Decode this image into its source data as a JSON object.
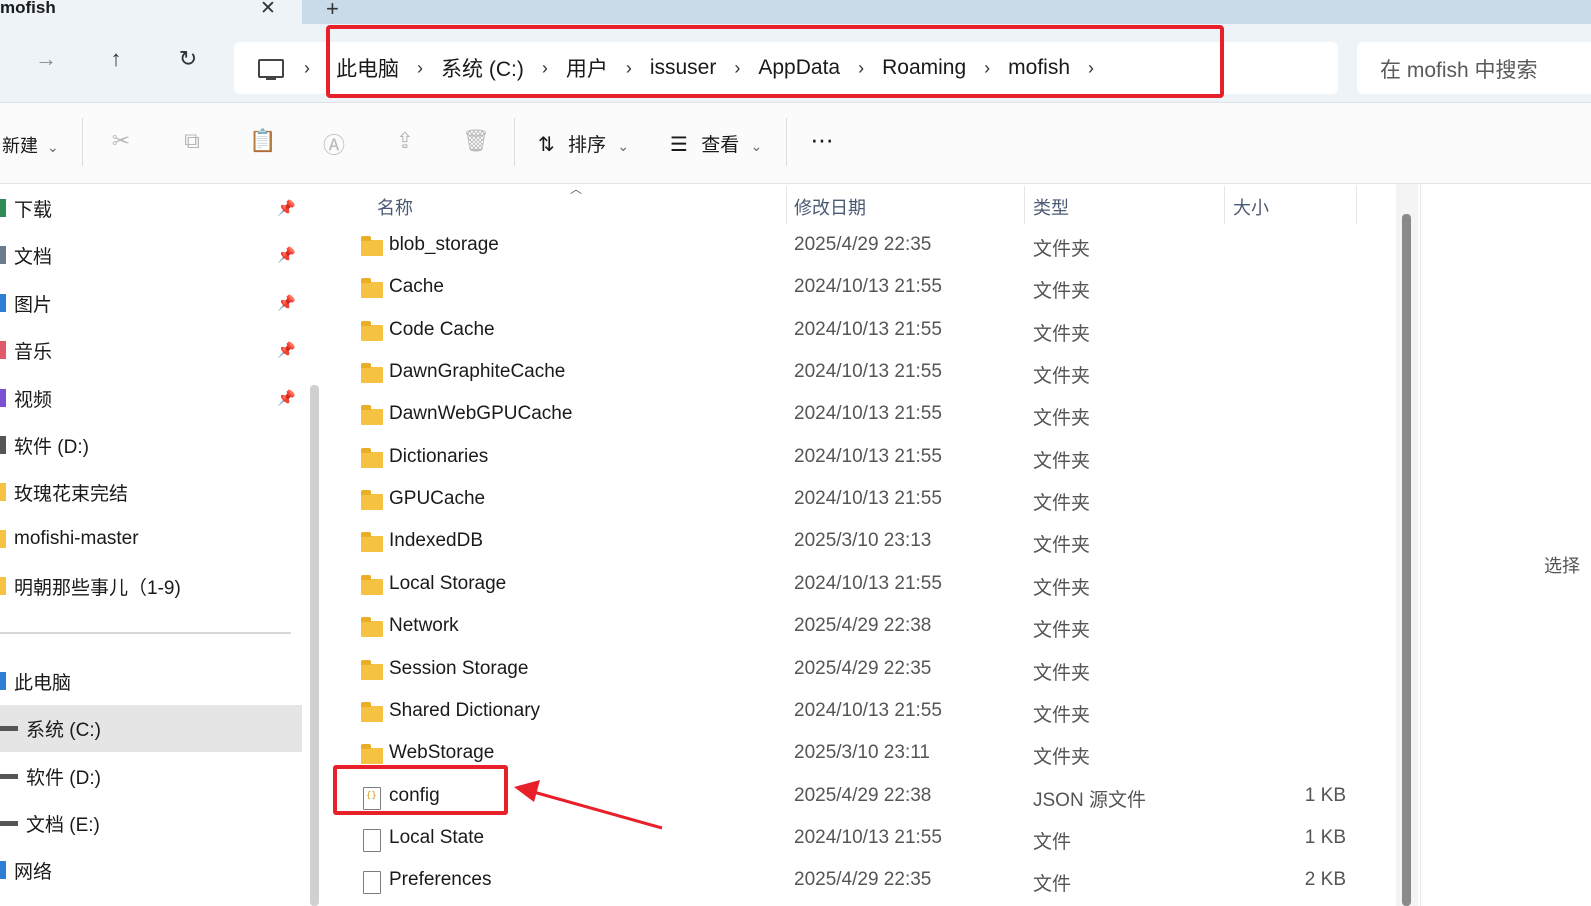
{
  "window": {
    "tab_title": "mofish",
    "close_glyph": "✕",
    "new_tab_glyph": "+"
  },
  "nav": {
    "forward_glyph": "→",
    "up_glyph": "↑",
    "refresh_glyph": "↻",
    "separator": "›",
    "breadcrumb": [
      "此电脑",
      "系统 (C:)",
      "用户",
      "issuser",
      "AppData",
      "Roaming",
      "mofish"
    ],
    "search_placeholder": "在 mofish 中搜索"
  },
  "toolbar": {
    "new_label": "新建",
    "sort_label": "排序",
    "view_label": "查看",
    "more_label": "···",
    "dropdown_glyph": "⌄",
    "icons": [
      "cut-icon",
      "copy-icon",
      "paste-icon",
      "rename-icon",
      "share-icon",
      "delete-icon"
    ]
  },
  "sidebar": {
    "quick_access": [
      {
        "label": "下载",
        "pinned": true,
        "color": "#2e8b57"
      },
      {
        "label": "文档",
        "pinned": true,
        "color": "#6b7b8c"
      },
      {
        "label": "图片",
        "pinned": true,
        "color": "#2d7fd3"
      },
      {
        "label": "音乐",
        "pinned": true,
        "color": "#e05a6a"
      },
      {
        "label": "视频",
        "pinned": true,
        "color": "#7a4fd0"
      },
      {
        "label": "软件 (D:)",
        "pinned": false,
        "color": "#555555"
      },
      {
        "label": "玫瑰花束完结",
        "pinned": false,
        "color": "#f5c242"
      },
      {
        "label": "mofishi-master",
        "pinned": false,
        "color": "#f5c242"
      },
      {
        "label": "明朝那些事儿（1-9)",
        "pinned": false,
        "color": "#f5c242"
      }
    ],
    "pin_glyph": "📌",
    "this_pc": [
      {
        "label": "此电脑",
        "color": "#2d7fd3"
      },
      {
        "label": "系统 (C:)",
        "color": "#555555",
        "selected": true
      },
      {
        "label": "软件 (D:)",
        "color": "#555555"
      },
      {
        "label": "文档 (E:)",
        "color": "#555555"
      },
      {
        "label": "网络",
        "color": "#2d7fd3"
      }
    ]
  },
  "columns": {
    "name": "名称",
    "date": "修改日期",
    "type": "类型",
    "size": "大小"
  },
  "files": [
    {
      "name": "blob_storage",
      "date": "2025/4/29 22:35",
      "type": "文件夹",
      "size": "",
      "kind": "folder"
    },
    {
      "name": "Cache",
      "date": "2024/10/13 21:55",
      "type": "文件夹",
      "size": "",
      "kind": "folder"
    },
    {
      "name": "Code Cache",
      "date": "2024/10/13 21:55",
      "type": "文件夹",
      "size": "",
      "kind": "folder"
    },
    {
      "name": "DawnGraphiteCache",
      "date": "2024/10/13 21:55",
      "type": "文件夹",
      "size": "",
      "kind": "folder"
    },
    {
      "name": "DawnWebGPUCache",
      "date": "2024/10/13 21:55",
      "type": "文件夹",
      "size": "",
      "kind": "folder"
    },
    {
      "name": "Dictionaries",
      "date": "2024/10/13 21:55",
      "type": "文件夹",
      "size": "",
      "kind": "folder"
    },
    {
      "name": "GPUCache",
      "date": "2024/10/13 21:55",
      "type": "文件夹",
      "size": "",
      "kind": "folder"
    },
    {
      "name": "IndexedDB",
      "date": "2025/3/10 23:13",
      "type": "文件夹",
      "size": "",
      "kind": "folder"
    },
    {
      "name": "Local Storage",
      "date": "2024/10/13 21:55",
      "type": "文件夹",
      "size": "",
      "kind": "folder"
    },
    {
      "name": "Network",
      "date": "2025/4/29 22:38",
      "type": "文件夹",
      "size": "",
      "kind": "folder"
    },
    {
      "name": "Session Storage",
      "date": "2025/4/29 22:35",
      "type": "文件夹",
      "size": "",
      "kind": "folder"
    },
    {
      "name": "Shared Dictionary",
      "date": "2024/10/13 21:55",
      "type": "文件夹",
      "size": "",
      "kind": "folder"
    },
    {
      "name": "WebStorage",
      "date": "2025/3/10 23:11",
      "type": "文件夹",
      "size": "",
      "kind": "folder"
    },
    {
      "name": "config",
      "date": "2025/4/29 22:38",
      "type": "JSON 源文件",
      "size": "1 KB",
      "kind": "json"
    },
    {
      "name": "Local State",
      "date": "2024/10/13 21:55",
      "type": "文件",
      "size": "1 KB",
      "kind": "file"
    },
    {
      "name": "Preferences",
      "date": "2025/4/29 22:35",
      "type": "文件",
      "size": "2 KB",
      "kind": "file"
    }
  ],
  "right_pane_hint": "选择",
  "annotation": {
    "highlight_color": "#e8202a"
  }
}
